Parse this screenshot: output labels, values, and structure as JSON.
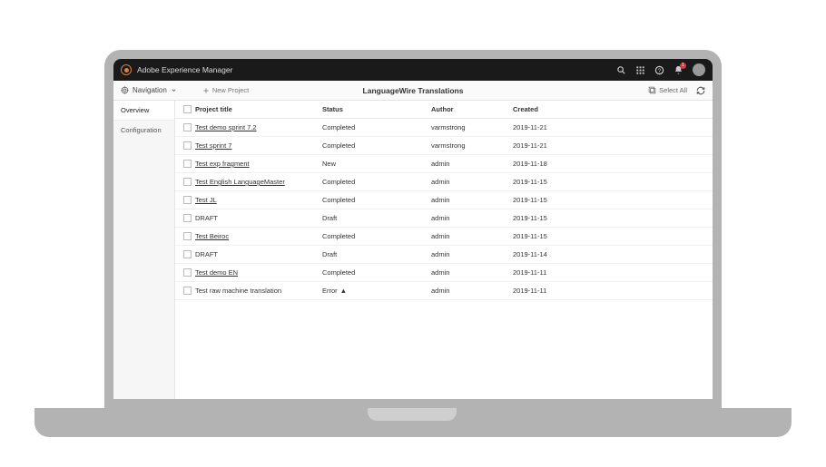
{
  "header": {
    "product": "Adobe Experience Manager",
    "notification_count": "1"
  },
  "toolbar": {
    "navigation_label": "Navigation",
    "new_project_label": "New Project",
    "page_title": "LanguageWire Translations",
    "select_all_label": "Select All"
  },
  "sidebar": {
    "items": [
      {
        "label": "Overview",
        "active": true
      },
      {
        "label": "Configuration",
        "active": false
      }
    ]
  },
  "columns": {
    "title": "Project title",
    "status": "Status",
    "author": "Author",
    "created": "Created"
  },
  "rows": [
    {
      "title": "Test demo sprint 7.2",
      "link": true,
      "status": "Completed",
      "author": "varmstrong",
      "created": "2019-11-21"
    },
    {
      "title": "Test sprint 7",
      "link": true,
      "status": "Completed",
      "author": "varmstrong",
      "created": "2019-11-21"
    },
    {
      "title": "Test exp fragment",
      "link": true,
      "status": "New",
      "author": "admin",
      "created": "2019-11-18"
    },
    {
      "title": "Test English LanguageMaster",
      "link": true,
      "status": "Completed",
      "author": "admin",
      "created": "2019-11-15"
    },
    {
      "title": "Test JL",
      "link": true,
      "status": "Completed",
      "author": "admin",
      "created": "2019-11-15"
    },
    {
      "title": "DRAFT",
      "link": false,
      "status": "Draft",
      "author": "admin",
      "created": "2019-11-15"
    },
    {
      "title": "Test Beiroc",
      "link": true,
      "status": "Completed",
      "author": "admin",
      "created": "2019-11-15"
    },
    {
      "title": "DRAFT",
      "link": false,
      "status": "Draft",
      "author": "admin",
      "created": "2019-11-14"
    },
    {
      "title": "Test demo EN",
      "link": true,
      "status": "Completed",
      "author": "admin",
      "created": "2019-11-11"
    },
    {
      "title": "Test raw machine translation",
      "link": false,
      "status": "Error",
      "error": true,
      "author": "admin",
      "created": "2019-11-11"
    }
  ]
}
